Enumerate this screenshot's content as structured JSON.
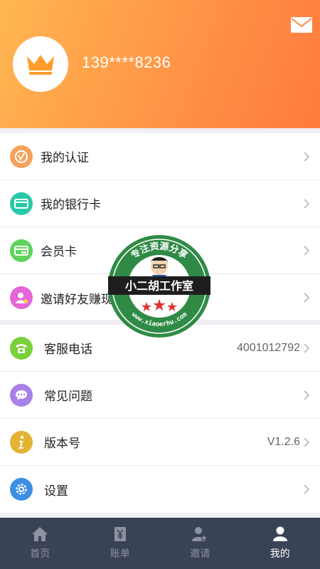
{
  "header": {
    "phone": "139****8236",
    "avatar_icon": "crown-icon",
    "mail_icon": "mail-icon",
    "gradient_from": "#ffb651",
    "gradient_to": "#ff7a3e"
  },
  "menu_group1": [
    {
      "label": "我的认证",
      "icon": "verify-icon",
      "color": "#f5a25c"
    },
    {
      "label": "我的银行卡",
      "icon": "bank-card-icon",
      "color": "#29c8a8"
    },
    {
      "label": "会员卡",
      "icon": "vip-card-icon",
      "color": "#5fd35b"
    },
    {
      "label": "邀请好友赚现",
      "icon": "invite-user-icon",
      "color": "#e764d8"
    }
  ],
  "menu_group2": [
    {
      "label": "客服电话",
      "value": "4001012792",
      "icon": "phone-icon",
      "color": "#7ad03a"
    },
    {
      "label": "常见问题",
      "value": "",
      "icon": "chat-icon",
      "color": "#a780e8"
    },
    {
      "label": "版本号",
      "value": "V1.2.6",
      "icon": "info-icon",
      "color": "#e2b334"
    },
    {
      "label": "设置",
      "value": "",
      "icon": "gear-icon",
      "color": "#3c8fe3"
    }
  ],
  "tabbar": [
    {
      "label": "首页",
      "icon": "home-icon",
      "active": false
    },
    {
      "label": "账单",
      "icon": "bill-icon",
      "active": false
    },
    {
      "label": "邀请",
      "icon": "invite-icon",
      "active": false
    },
    {
      "label": "我的",
      "icon": "user-icon",
      "active": true
    }
  ],
  "watermark": {
    "top_text": "专注资源分享",
    "main_text": "小二胡工作室",
    "bottom_text": "www.xiaoerhu.com"
  }
}
